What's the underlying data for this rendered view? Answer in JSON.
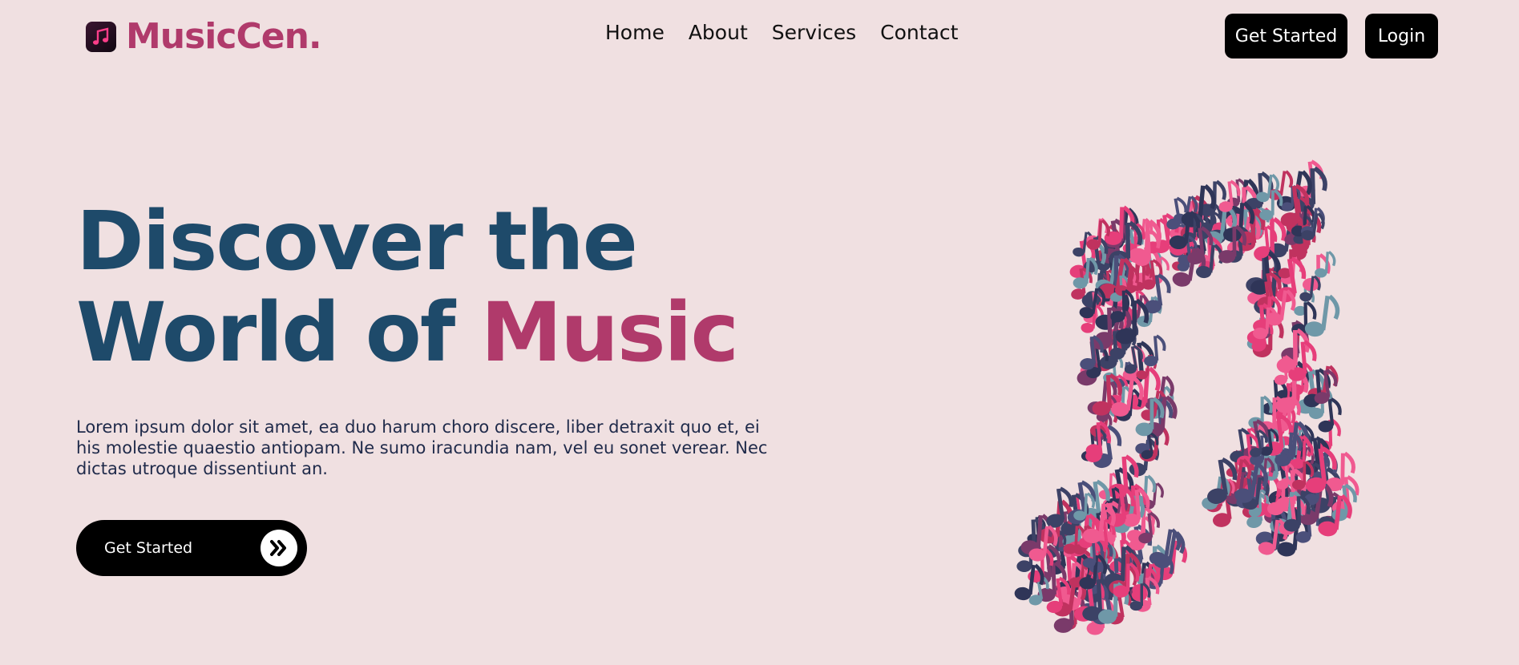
{
  "brand": {
    "name": "MusicCen.",
    "icon": "music-note-app-icon"
  },
  "nav": {
    "links": [
      "Home",
      "About",
      "Services",
      "Contact"
    ],
    "get_started": "Get Started",
    "login": "Login"
  },
  "hero": {
    "line1": "Discover the",
    "line2_prefix": "World of",
    "line2_accent": "Music",
    "description": "Lorem ipsum dolor sit amet, ea duo harum choro discere, liber detraxit quo et, ei his molestie quaestio antiopam. Ne sumo iracundia nam, vel eu sonet verear. Nec dictas utroque dissentiunt an.",
    "cta_label": "Get Started",
    "cta_icon": "double-chevron-right-icon",
    "illustration": "3d-music-note-illustration"
  },
  "colors": {
    "background": "#f0e0e1",
    "accent": "#b03a6b",
    "headline": "#1e4a6a",
    "button": "#000000"
  }
}
